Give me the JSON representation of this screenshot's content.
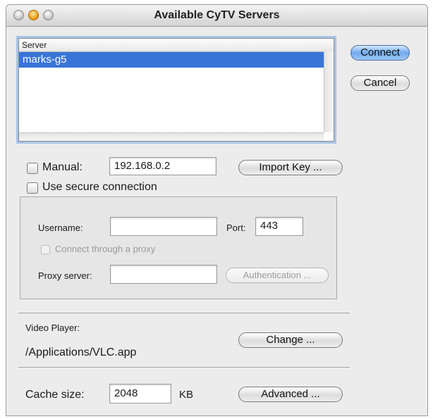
{
  "window": {
    "title": "Available CyTV Servers"
  },
  "server_list": {
    "column_header": "Server",
    "rows": [
      "marks-g5"
    ]
  },
  "buttons": {
    "connect": "Connect",
    "cancel": "Cancel",
    "import_key": "Import Key ...",
    "authentication": "Authentication ...",
    "change": "Change ...",
    "advanced": "Advanced ..."
  },
  "manual": {
    "label": "Manual:",
    "value": "192.168.0.2",
    "checked": false
  },
  "secure": {
    "label": "Use secure connection",
    "checked": false
  },
  "credentials": {
    "username_label": "Username:",
    "username_value": "",
    "port_label": "Port:",
    "port_value": "443",
    "proxy_checkbox_label": "Connect through a proxy",
    "proxy_server_label": "Proxy server:",
    "proxy_server_value": ""
  },
  "video_player": {
    "label": "Video Player:",
    "path": "/Applications/VLC.app"
  },
  "cache": {
    "label": "Cache size:",
    "value": "2048",
    "unit": "KB"
  }
}
